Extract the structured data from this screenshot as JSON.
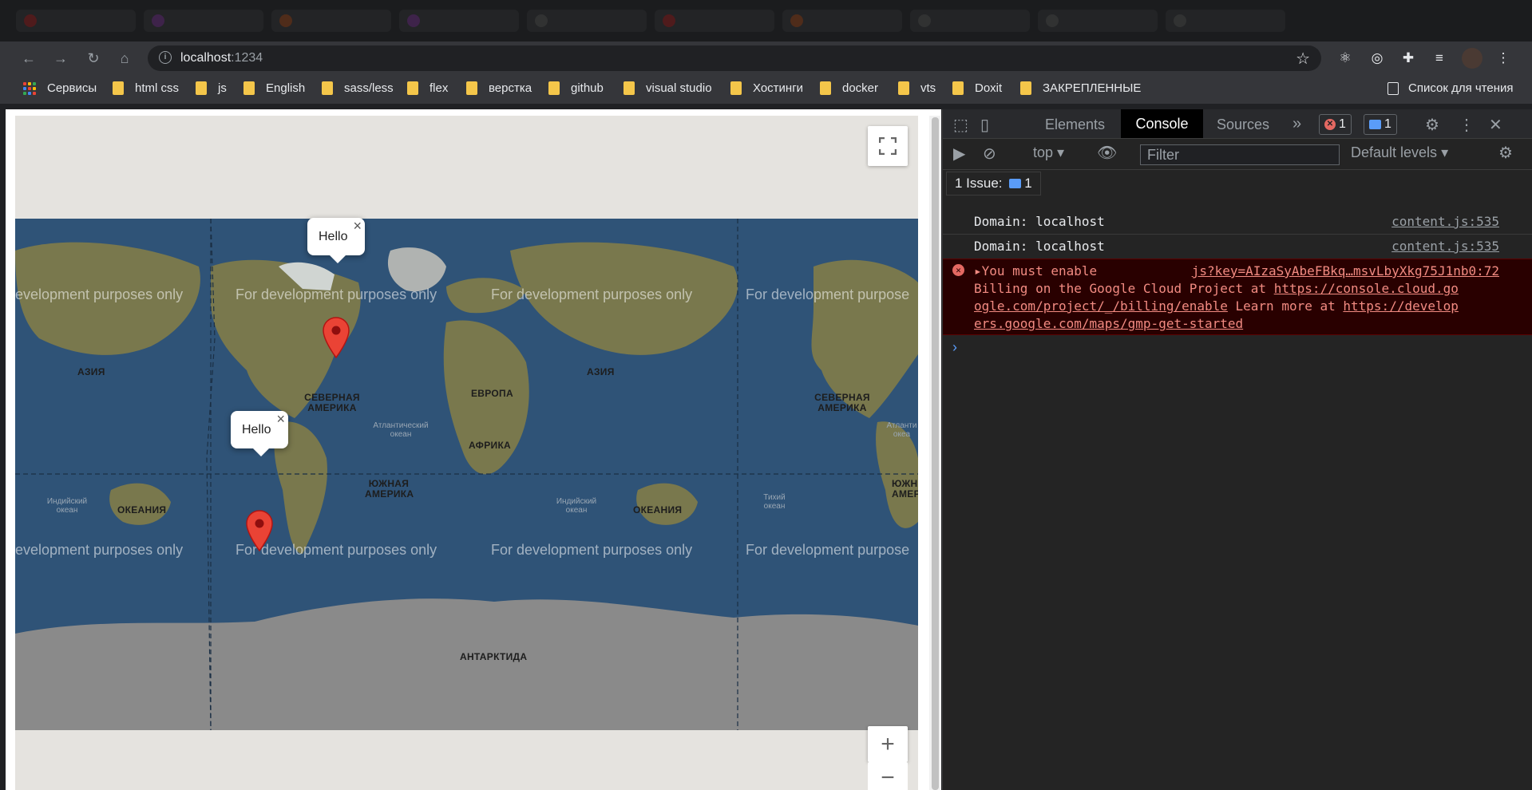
{
  "browser": {
    "url_host": "localhost",
    "url_port": ":1234"
  },
  "bookmarks": [
    {
      "label": "Сервисы",
      "type": "apps"
    },
    {
      "label": "html css",
      "type": "folder"
    },
    {
      "label": "js",
      "type": "folder"
    },
    {
      "label": "English",
      "type": "folder"
    },
    {
      "label": "sass/less",
      "type": "folder"
    },
    {
      "label": "flex",
      "type": "folder"
    },
    {
      "label": "верстка",
      "type": "folder"
    },
    {
      "label": "github",
      "type": "folder"
    },
    {
      "label": "visual studio",
      "type": "folder"
    },
    {
      "label": "Хостинги",
      "type": "folder"
    },
    {
      "label": "docker",
      "type": "folder"
    },
    {
      "label": "vts",
      "type": "folder"
    },
    {
      "label": "Doxit",
      "type": "folder"
    },
    {
      "label": "ЗАКРЕПЛЕННЫЕ",
      "type": "folder"
    }
  ],
  "reading_list_label": "Список для чтения",
  "map": {
    "watermark": "For development purposes only",
    "watermark_partial_left": "evelopment purposes only",
    "watermark_partial_right": "For development purpose",
    "infowindow_text": "Hello",
    "zoom_in": "+",
    "zoom_out": "−",
    "labels": {
      "asia": "АЗИЯ",
      "north_america": "СЕВЕРНАЯ АМЕРИКА",
      "europe": "ЕВРОПА",
      "africa": "АФРИКА",
      "south_america": "ЮЖНАЯ АМЕРИКА",
      "oceania": "ОКЕАНИЯ",
      "antarctica": "АНТАРКТИДА",
      "atlantic": "Атлантический океан",
      "indian": "Индийский океан",
      "pacific": "Тихий океан",
      "atlantic_partial": "Атланти океа",
      "south_america_partial": "ЮЖНА АМЕРИК"
    }
  },
  "devtools": {
    "tabs": [
      "Elements",
      "Console",
      "Sources"
    ],
    "active_tab": "Console",
    "error_count": "1",
    "message_count": "1",
    "context": "top",
    "filter_placeholder": "Filter",
    "levels": "Default levels",
    "issues_label": "1 Issue:",
    "issues_count": "1",
    "logs": [
      {
        "message": "Domain: localhost",
        "source": "content.js:535"
      },
      {
        "message": "Domain: localhost",
        "source": "content.js:535"
      }
    ],
    "error": {
      "line1": "You must enable",
      "source": "js?key=AIzaSyAbeFBkq…msvLbyXkg75J1nb0:72",
      "line2_text": "Billing on the Google Cloud Project at ",
      "line2_link": "https://console.cloud.go",
      "line3_link": "ogle.com/project/_/billing/enable",
      "line3_text": " Learn more at ",
      "line3_link2": "https://develop",
      "line4_link": "ers.google.com/maps/gmp-get-started"
    }
  }
}
